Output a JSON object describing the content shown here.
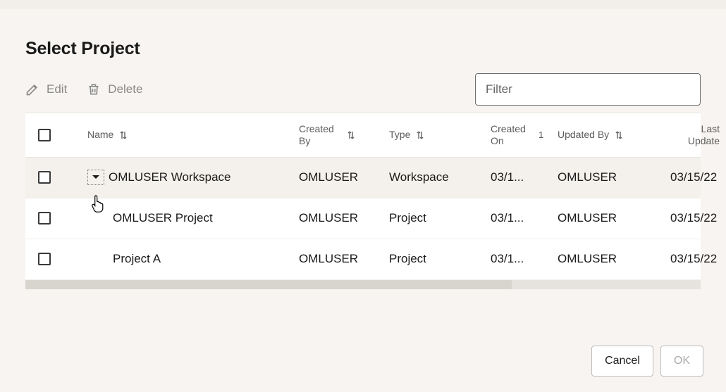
{
  "page_title": "Select Project",
  "toolbar": {
    "edit_label": "Edit",
    "delete_label": "Delete",
    "filter_placeholder": "Filter"
  },
  "columns": {
    "name": "Name",
    "created_by": "Created By",
    "type": "Type",
    "created_on": "Created On",
    "created_on_sort_badge": "1",
    "updated_by": "Updated By",
    "last_update": "Last Update"
  },
  "rows": [
    {
      "name": "OMLUSER Workspace",
      "created_by": "OMLUSER",
      "type": "Workspace",
      "created_on": "03/1...",
      "updated_by": "OMLUSER",
      "last_update": "03/15/22",
      "level": 0,
      "expanded": true,
      "hover": true
    },
    {
      "name": "OMLUSER Project",
      "created_by": "OMLUSER",
      "type": "Project",
      "created_on": "03/1...",
      "updated_by": "OMLUSER",
      "last_update": "03/15/22",
      "level": 1
    },
    {
      "name": "Project A",
      "created_by": "OMLUSER",
      "type": "Project",
      "created_on": "03/1...",
      "updated_by": "OMLUSER",
      "last_update": "03/15/22",
      "level": 1
    }
  ],
  "footer": {
    "cancel_label": "Cancel",
    "ok_label": "OK"
  }
}
